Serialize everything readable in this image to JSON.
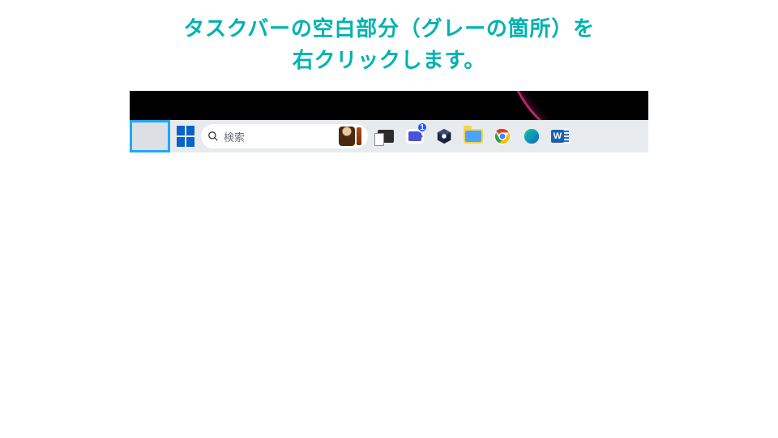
{
  "instruction": {
    "line1": "タスクバーの空白部分（グレーの箇所）を",
    "line2": "右クリックします。"
  },
  "search": {
    "placeholder": "検索"
  },
  "chat_badge": "1",
  "word_letter": "W",
  "icons": {
    "start": "windows-start-icon",
    "search": "search-icon",
    "taskview": "task-view-icon",
    "chat": "chat-icon",
    "hex": "app-cube-icon",
    "folder": "file-explorer-icon",
    "chrome": "chrome-icon",
    "edge": "edge-icon",
    "word": "word-icon"
  },
  "colors": {
    "accent": "#00b3b0",
    "highlight": "#1ea7ff"
  }
}
